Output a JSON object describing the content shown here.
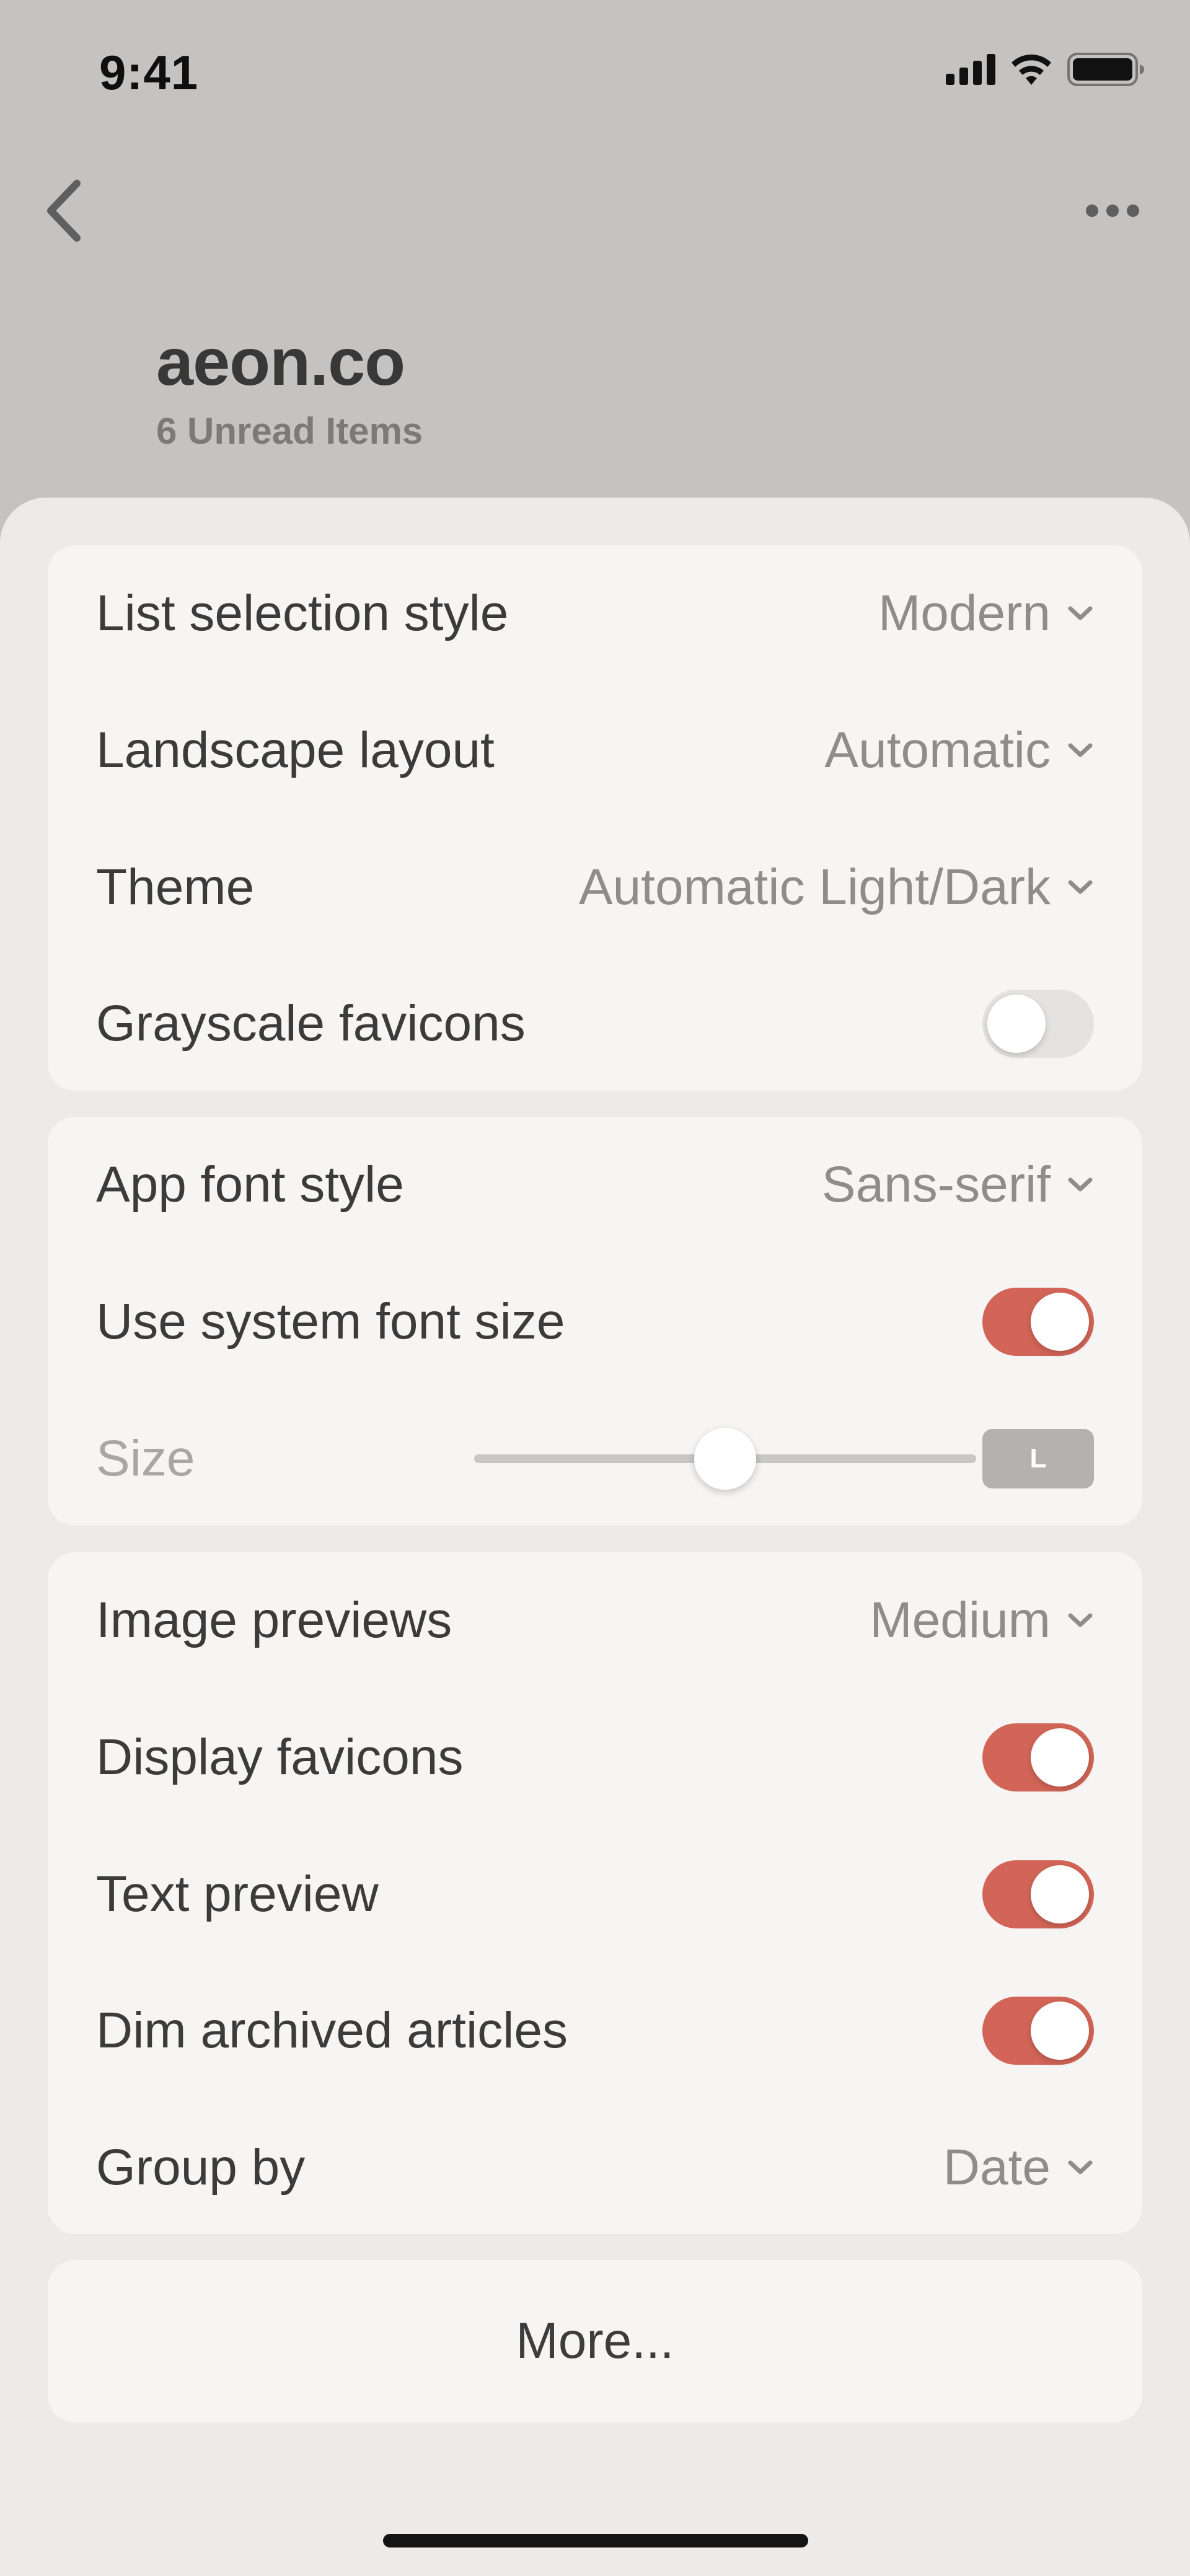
{
  "status_bar": {
    "time": "9:41",
    "icons": [
      "cellular-signal-icon",
      "wifi-icon",
      "battery-icon"
    ]
  },
  "nav": {
    "back_icon": "chevron-left-icon",
    "more_icon": "ellipsis-icon"
  },
  "feed": {
    "title": "aeon.co",
    "subtitle": "6 Unread Items"
  },
  "groups": {
    "appearance": {
      "list_selection_style": {
        "label": "List selection style",
        "value": "Modern"
      },
      "landscape_layout": {
        "label": "Landscape layout",
        "value": "Automatic"
      },
      "theme": {
        "label": "Theme",
        "value": "Automatic Light/Dark"
      },
      "grayscale_favicons": {
        "label": "Grayscale favicons",
        "enabled": false
      }
    },
    "font": {
      "app_font_style": {
        "label": "App font style",
        "value": "Sans-serif"
      },
      "use_system_font_size": {
        "label": "Use system font size",
        "enabled": true
      },
      "size": {
        "label": "Size",
        "slider_level": 0.5,
        "badge": "L"
      }
    },
    "list": {
      "image_previews": {
        "label": "Image previews",
        "value": "Medium"
      },
      "display_favicons": {
        "label": "Display favicons",
        "enabled": true
      },
      "text_preview": {
        "label": "Text preview",
        "enabled": true
      },
      "dim_archived_articles": {
        "label": "Dim archived articles",
        "enabled": true
      },
      "group_by": {
        "label": "Group by",
        "value": "Date"
      }
    }
  },
  "more_button": {
    "label": "More..."
  },
  "colors": {
    "accent": "#d26557",
    "sheet_background": "#ecebe9",
    "group_background": "#f6f5f4",
    "dimmed_background": "#c4c3c2"
  }
}
